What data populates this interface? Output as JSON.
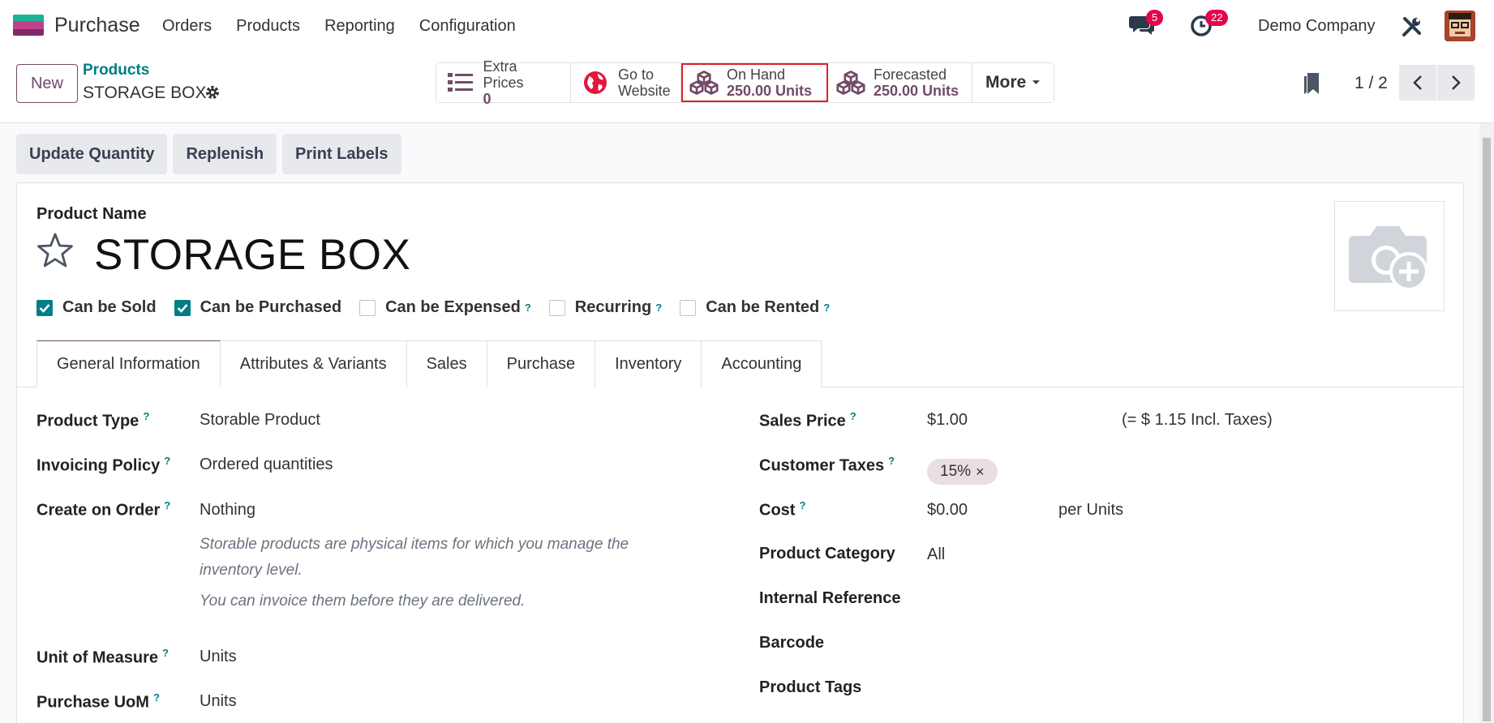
{
  "navbar": {
    "app_name": "Purchase",
    "menu": [
      "Orders",
      "Products",
      "Reporting",
      "Configuration"
    ],
    "chat_badge": "5",
    "activity_badge": "22",
    "company": "Demo Company"
  },
  "control": {
    "new_label": "New",
    "breadcrumb": "Products",
    "record_name": "STORAGE BOX",
    "smart_buttons": [
      {
        "line1": "Extra Prices",
        "line2": "0"
      },
      {
        "line1": "Go to",
        "line2": "Website"
      },
      {
        "line1": "On Hand",
        "line2": "250.00 Units"
      },
      {
        "line1": "Forecasted",
        "line2": "250.00 Units"
      }
    ],
    "more_label": "More",
    "pager": "1 / 2"
  },
  "actions": [
    "Update Quantity",
    "Replenish",
    "Print Labels"
  ],
  "form": {
    "product_name_label": "Product Name",
    "product_name": "STORAGE BOX",
    "checkboxes": [
      {
        "label": "Can be Sold",
        "checked": true,
        "help": ""
      },
      {
        "label": "Can be Purchased",
        "checked": true,
        "help": ""
      },
      {
        "label": "Can be Expensed",
        "checked": false,
        "help": "?"
      },
      {
        "label": "Recurring",
        "checked": false,
        "help": "?"
      },
      {
        "label": "Can be Rented",
        "checked": false,
        "help": "?"
      }
    ],
    "tabs": [
      "General Information",
      "Attributes & Variants",
      "Sales",
      "Purchase",
      "Inventory",
      "Accounting"
    ],
    "left": {
      "product_type_label": "Product Type",
      "product_type": "Storable Product",
      "invoicing_policy_label": "Invoicing Policy",
      "invoicing_policy": "Ordered quantities",
      "create_on_order_label": "Create on Order",
      "create_on_order": "Nothing",
      "note1": "Storable products are physical items for which you manage the inventory level.",
      "note2": "You can invoice them before they are delivered.",
      "uom_label": "Unit of Measure",
      "uom": "Units",
      "purchase_uom_label": "Purchase UoM",
      "purchase_uom": "Units"
    },
    "right": {
      "sales_price_label": "Sales Price",
      "sales_price": "$1.00",
      "incl_taxes": "(= $ 1.15 Incl. Taxes)",
      "customer_taxes_label": "Customer Taxes",
      "customer_tax_tag": "15%",
      "cost_label": "Cost",
      "cost": "$0.00",
      "cost_unit": "per Units",
      "category_label": "Product Category",
      "category": "All",
      "internal_ref_label": "Internal Reference",
      "barcode_label": "Barcode",
      "tags_label": "Product Tags"
    },
    "help_mark": "?"
  }
}
